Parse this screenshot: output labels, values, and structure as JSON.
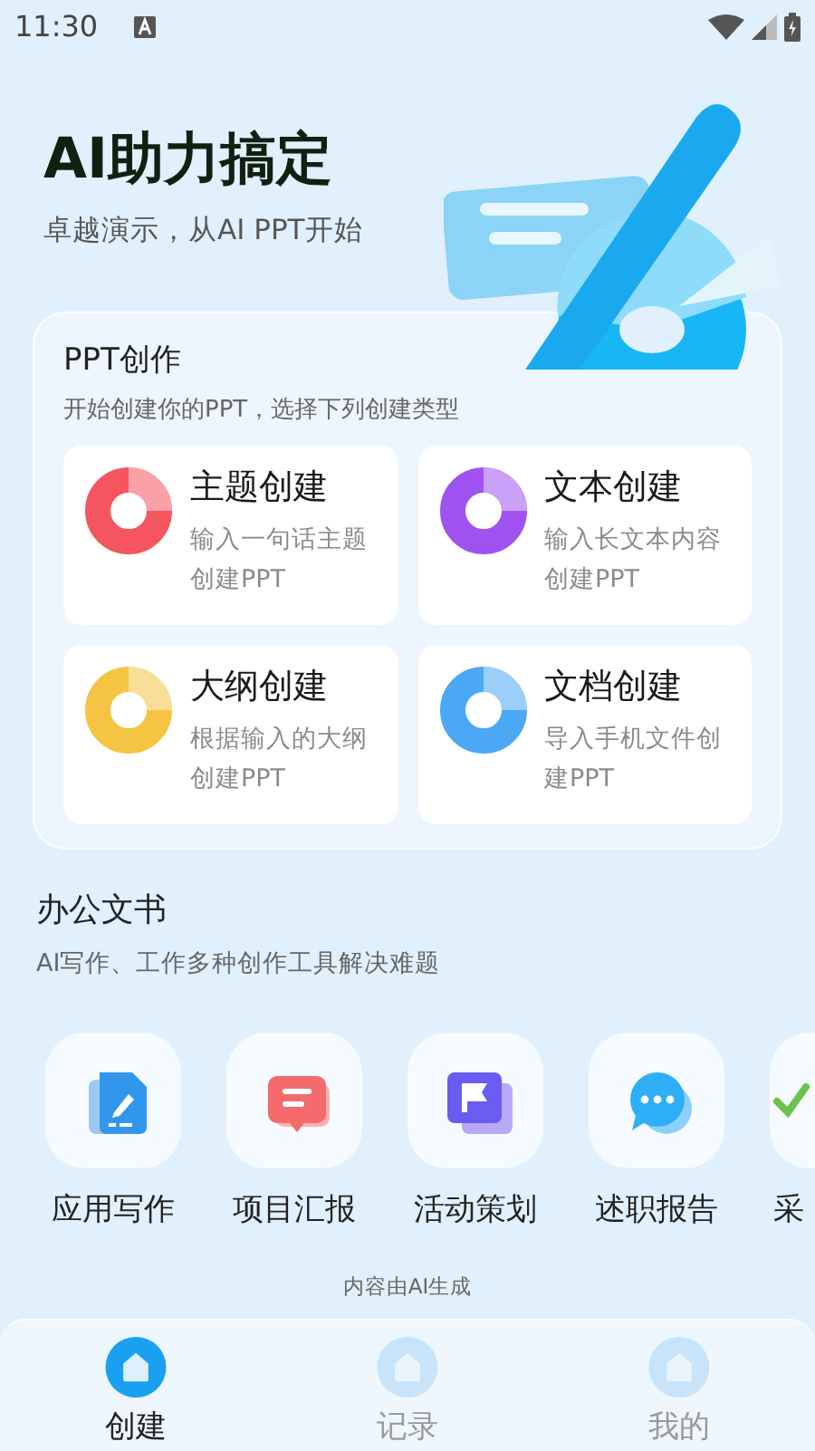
{
  "status_bar": {
    "time": "11:30"
  },
  "hero": {
    "title": "AI助力搞定",
    "subtitle": "卓越演示，从AI PPT开始"
  },
  "ppt_section": {
    "title": "PPT创作",
    "subtitle": "开始创建你的PPT，选择下列创建类型",
    "cards": [
      {
        "title": "主题创建",
        "description": "输入一句话主题创建PPT",
        "color": "#f4555f"
      },
      {
        "title": "文本创建",
        "description": "输入长文本内容创建PPT",
        "color": "#a052f0"
      },
      {
        "title": "大纲创建",
        "description": "根据输入的大纲创建PPT",
        "color": "#f5c443"
      },
      {
        "title": "文档创建",
        "description": "导入手机文件创建PPT",
        "color": "#4aa8f5"
      }
    ]
  },
  "office_section": {
    "title": "办公文书",
    "subtitle": "AI写作、工作多种创作工具解决难题",
    "tools": [
      {
        "label": "应用写作",
        "kind": "pen"
      },
      {
        "label": "项目汇报",
        "kind": "chat"
      },
      {
        "label": "活动策划",
        "kind": "flag"
      },
      {
        "label": "述职报告",
        "kind": "dots"
      },
      {
        "label": "采",
        "kind": "check"
      }
    ]
  },
  "disclaimer": "内容由AI生成",
  "bottom_nav": [
    {
      "label": "创建",
      "selected": true
    },
    {
      "label": "记录",
      "selected": false
    },
    {
      "label": "我的",
      "selected": false
    }
  ]
}
